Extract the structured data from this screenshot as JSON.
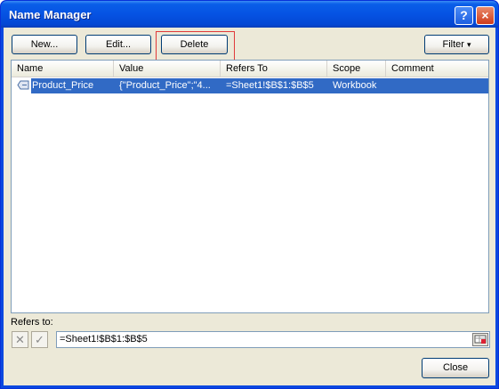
{
  "window": {
    "title": "Name Manager",
    "help_glyph": "?",
    "close_glyph": "×"
  },
  "toolbar": {
    "new_label": "New...",
    "edit_label": "Edit...",
    "delete_label": "Delete",
    "filter_label": "Filter",
    "filter_arrow": "▾"
  },
  "list": {
    "columns": [
      "Name",
      "Value",
      "Refers To",
      "Scope",
      "Comment"
    ],
    "rows": [
      {
        "name": "Product_Price",
        "value": "{\"Product_Price\";\"4...",
        "refers_to": "=Sheet1!$B$1:$B$5",
        "scope": "Workbook",
        "comment": ""
      }
    ],
    "selected_row": 0
  },
  "refers": {
    "label": "Refers to:",
    "value": "=Sheet1!$B$1:$B$5",
    "cancel_glyph": "✕",
    "confirm_glyph": "✓"
  },
  "footer": {
    "close_label": "Close"
  },
  "colors": {
    "title_bar": "#0553e3",
    "selection": "#316ac5",
    "dialog_bg": "#ece9d8",
    "highlight_border": "#e03a3a"
  }
}
